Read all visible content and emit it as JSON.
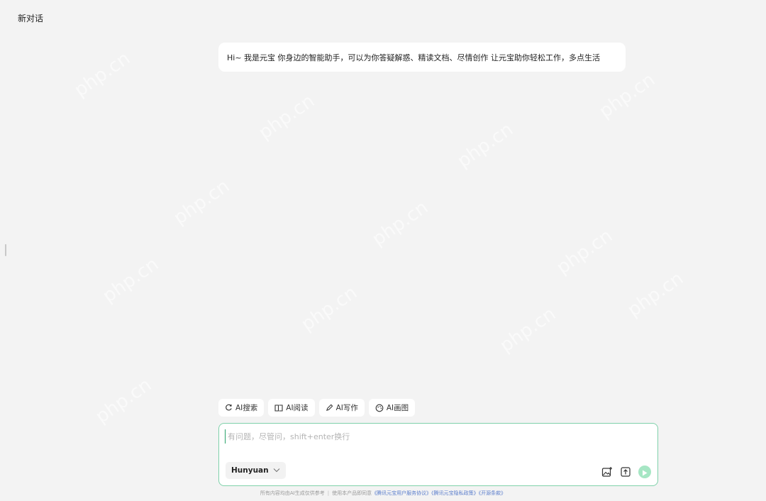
{
  "header": {
    "title": "新对话"
  },
  "greeting": {
    "text": "Hi~ 我是元宝 你身边的智能助手，可以为你答疑解惑、精读文档、尽情创作 让元宝助你轻松工作，多点生活"
  },
  "tools": [
    {
      "label": "AI搜索",
      "icon": "search-refresh-icon"
    },
    {
      "label": "AI阅读",
      "icon": "book-icon"
    },
    {
      "label": "AI写作",
      "icon": "pen-icon"
    },
    {
      "label": "AI画图",
      "icon": "palette-icon"
    }
  ],
  "composer": {
    "placeholder": "有问题，尽管问，shift+enter换行",
    "model": "Hunyuan",
    "actions": [
      "image-upload-icon",
      "file-upload-icon",
      "send-icon"
    ]
  },
  "footer": {
    "note": "所有内容均由AI生成仅供参考",
    "agree_prefix": "使用本产品即同意",
    "links": [
      "《腾讯元宝用户服务协议》",
      "《腾讯元宝隐私政策》",
      "《开源条款》"
    ]
  },
  "colors": {
    "accent": "#7fd1aa",
    "send": "#a6e6c4",
    "background": "#f3f3f3"
  },
  "watermark": "php.cn"
}
